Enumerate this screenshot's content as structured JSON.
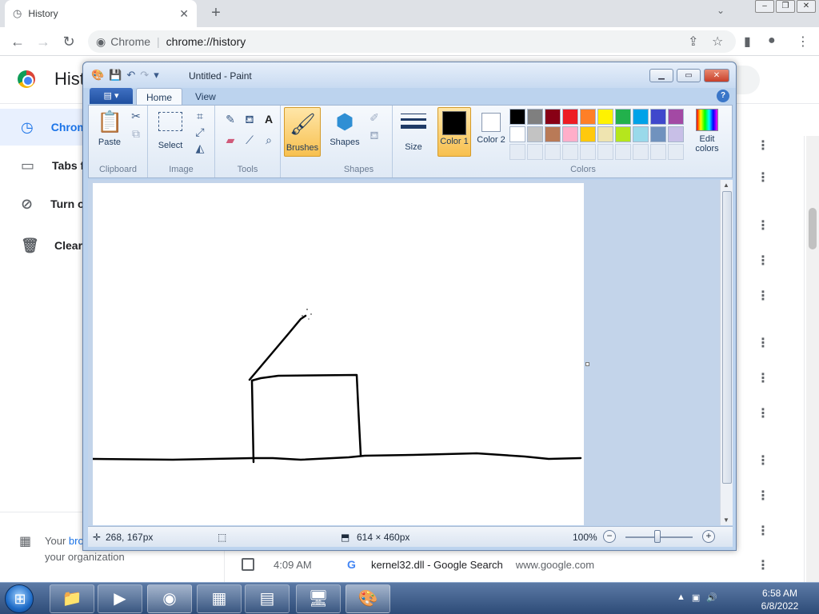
{
  "chrome": {
    "tab_title": "History",
    "tab_close": "✕",
    "new_tab": "+",
    "site_chip": "Chrome",
    "url": "chrome://history",
    "page_title": "History",
    "sidebar": [
      {
        "label": "Chrome history",
        "icon": "clock-icon",
        "glyph": "◷"
      },
      {
        "label": "Tabs from other devices",
        "icon": "devices-icon",
        "glyph": "▭"
      },
      {
        "label": "Turn off history",
        "icon": "history-off-icon",
        "glyph": "⊘"
      },
      {
        "label": "Clear browsing data",
        "icon": "trash-icon",
        "glyph": "🗑"
      }
    ],
    "managed_text_prefix": "Your ",
    "managed_link": "bro",
    "managed_text_line2": "your organization",
    "history_row": {
      "time": "4:09 AM",
      "favicon": "G",
      "title": "kernel32.dll - Google Search",
      "domain": "www.google.com"
    },
    "row_menu_glyph": "⋮"
  },
  "paint": {
    "window_title": "Untitled - Paint",
    "tabs": {
      "file": "▤ ▾",
      "home": "Home",
      "view": "View"
    },
    "groups": {
      "clipboard": "Clipboard",
      "image": "Image",
      "tools": "Tools",
      "shapes": "Shapes",
      "colors": "Colors"
    },
    "buttons": {
      "paste": "Paste",
      "select": "Select",
      "brushes": "Brushes",
      "shapes": "Shapes",
      "size": "Size",
      "color1": "Color 1",
      "color2": "Color 2",
      "edit_colors": "Edit colors"
    },
    "palette_row1": [
      "#000000",
      "#7f7f7f",
      "#880015",
      "#ed1c24",
      "#ff7f27",
      "#fff200",
      "#22b14c",
      "#00a2e8",
      "#3f48cc",
      "#a349a4"
    ],
    "palette_row2": [
      "#ffffff",
      "#c3c3c3",
      "#b97a57",
      "#ffaec9",
      "#ffc90e",
      "#efe4b0",
      "#b5e61d",
      "#99d9ea",
      "#7092be",
      "#c8bfe7"
    ],
    "status": {
      "cursor_pos": "268, 167px",
      "image_size": "614 × 460px",
      "zoom": "100%"
    }
  },
  "taskbar": {
    "time": "6:58 AM",
    "date": "6/8/2022"
  }
}
